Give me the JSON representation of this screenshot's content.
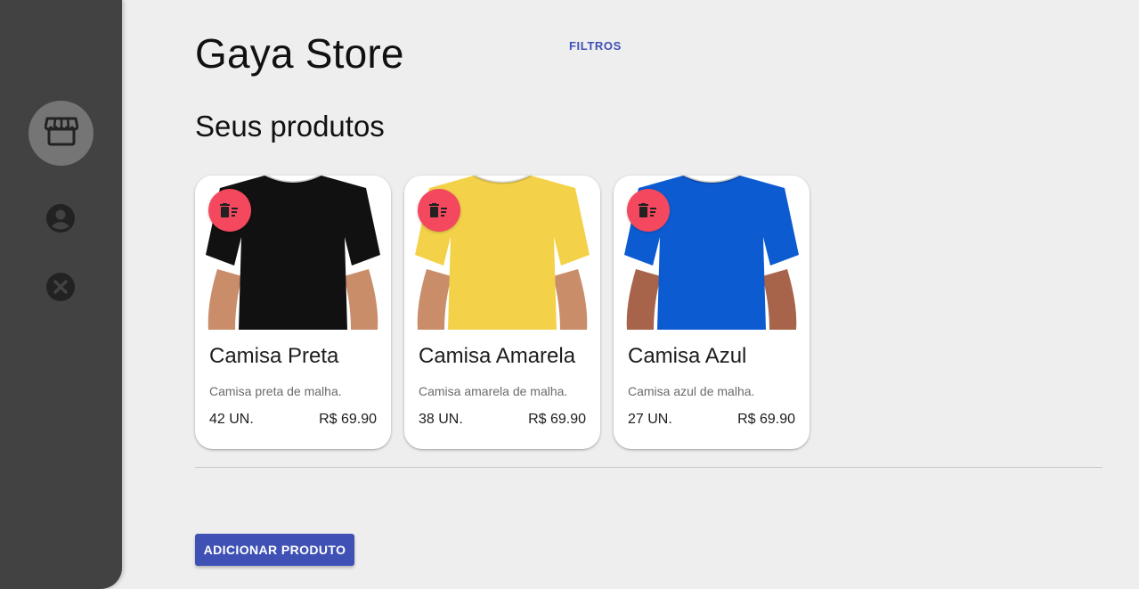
{
  "sidebar": {
    "items": [
      {
        "icon": "store-icon",
        "active": true
      },
      {
        "icon": "account-circle-icon",
        "active": false
      },
      {
        "icon": "close-circle-icon",
        "active": false
      }
    ]
  },
  "header": {
    "title": "Gaya Store",
    "filters_label": "FILTROS"
  },
  "section_title": "Seus produtos",
  "products": [
    {
      "name": "Camisa Preta",
      "description": "Camisa preta de malha.",
      "quantity": "42 UN.",
      "price": "R$ 69.90",
      "color": "#111111"
    },
    {
      "name": "Camisa Amarela",
      "description": "Camisa amarela de malha.",
      "quantity": "38 UN.",
      "price": "R$ 69.90",
      "color": "#f3d24a"
    },
    {
      "name": "Camisa Azul",
      "description": "Camisa azul de malha.",
      "quantity": "27 UN.",
      "price": "R$ 69.90",
      "color": "#0d5bd0"
    }
  ],
  "add_button_label": "ADICIONAR PRODUTO",
  "colors": {
    "sidebar": "#424242",
    "primary": "#3f51b5",
    "delete": "#f4485e",
    "background": "#eeeeee"
  }
}
